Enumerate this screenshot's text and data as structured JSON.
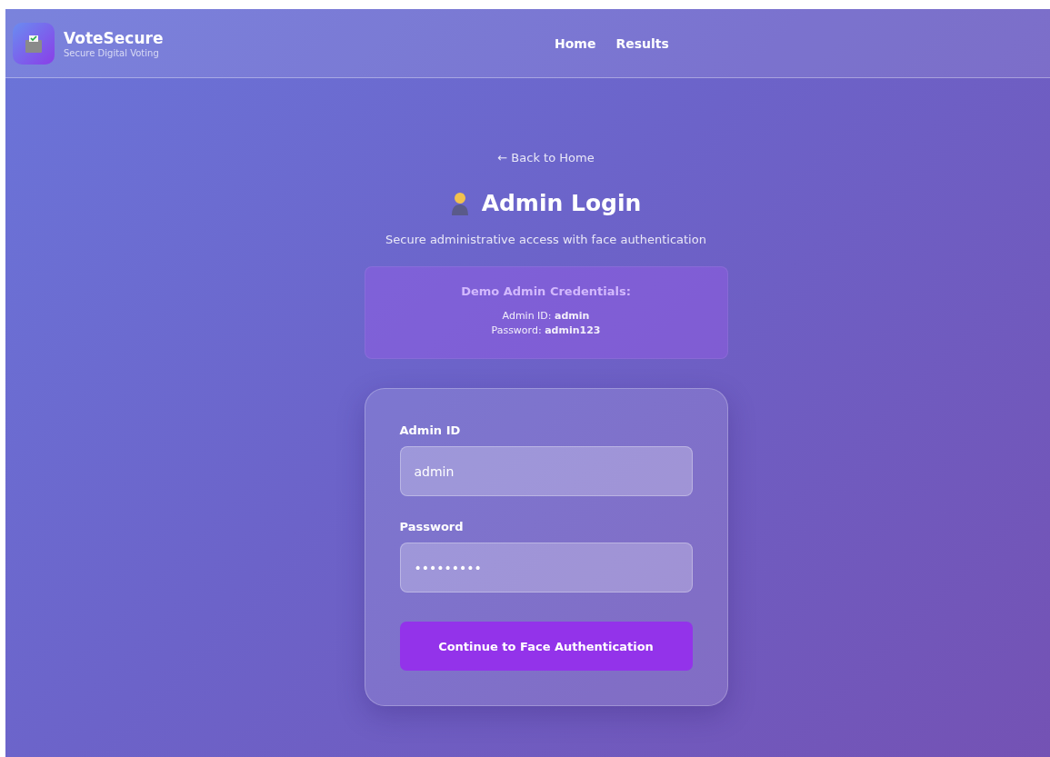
{
  "header": {
    "brand": "VoteSecure",
    "tagline": "Secure Digital Voting",
    "nav": [
      {
        "label": "Home"
      },
      {
        "label": "Results"
      }
    ]
  },
  "back_link": "← Back to Home",
  "title": "Admin Login",
  "subtitle": "Secure administrative access with face authentication",
  "demo": {
    "heading": "Demo Admin Credentials:",
    "lines": [
      "Admin ID: **admin**",
      "Password: **admin123**"
    ]
  },
  "form": {
    "fields": [
      {
        "label": "Admin ID",
        "value": "admin"
      },
      {
        "label": "Password",
        "value": "•••••••••"
      }
    ],
    "submit": "Continue to Face Authentication"
  }
}
